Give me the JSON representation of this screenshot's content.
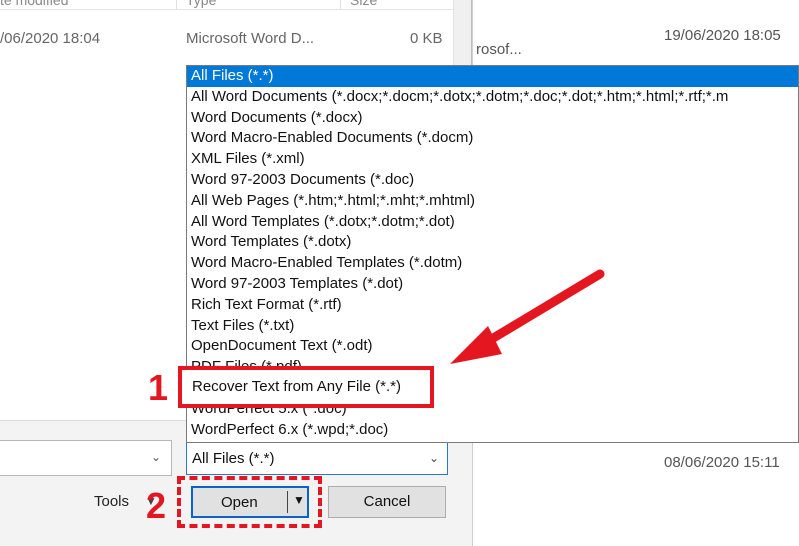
{
  "background_window": {
    "file_fragment": "rosof...",
    "date_top": "19/06/2020 18:05",
    "date_bottom": "08/06/2020 15:11"
  },
  "file_list": {
    "headers": {
      "date_modified": "te modified",
      "type": "Type",
      "size": "Size"
    },
    "rows": [
      {
        "date": "/06/2020 18:04",
        "type": "Microsoft Word D...",
        "size": "0 KB"
      }
    ]
  },
  "file_type_dropdown": {
    "items": [
      "All Files (*.*)",
      "All Word Documents (*.docx;*.docm;*.dotx;*.dotm;*.doc;*.dot;*.htm;*.html;*.rtf;*.m",
      "Word Documents (*.docx)",
      "Word Macro-Enabled Documents (*.docm)",
      "XML Files (*.xml)",
      "Word 97-2003 Documents (*.doc)",
      "All Web Pages (*.htm;*.html;*.mht;*.mhtml)",
      "All Word Templates (*.dotx;*.dotm;*.dot)",
      "Word Templates (*.dotx)",
      "Word Macro-Enabled Templates (*.dotm)",
      "Word 97-2003 Templates (*.dot)",
      "Rich Text Format (*.rtf)",
      "Text Files (*.txt)",
      "OpenDocument Text (*.odt)",
      "PDF Files (*.pdf)",
      "Recover Text from Any File (*.*)",
      "WordPerfect 5.x (*.doc)",
      "WordPerfect 6.x (*.wpd;*.doc)"
    ],
    "selected_index": 0,
    "combo_value": "All Files (*.*)"
  },
  "buttons": {
    "tools": "Tools",
    "open": "Open",
    "cancel": "Cancel"
  },
  "annotations": {
    "step1": "1",
    "step2": "2",
    "highlighted_option": "Recover Text from Any File (*.*)",
    "color": "#e4161f"
  },
  "colors": {
    "selection": "#0078d7",
    "focus_border": "#0a63c9"
  }
}
